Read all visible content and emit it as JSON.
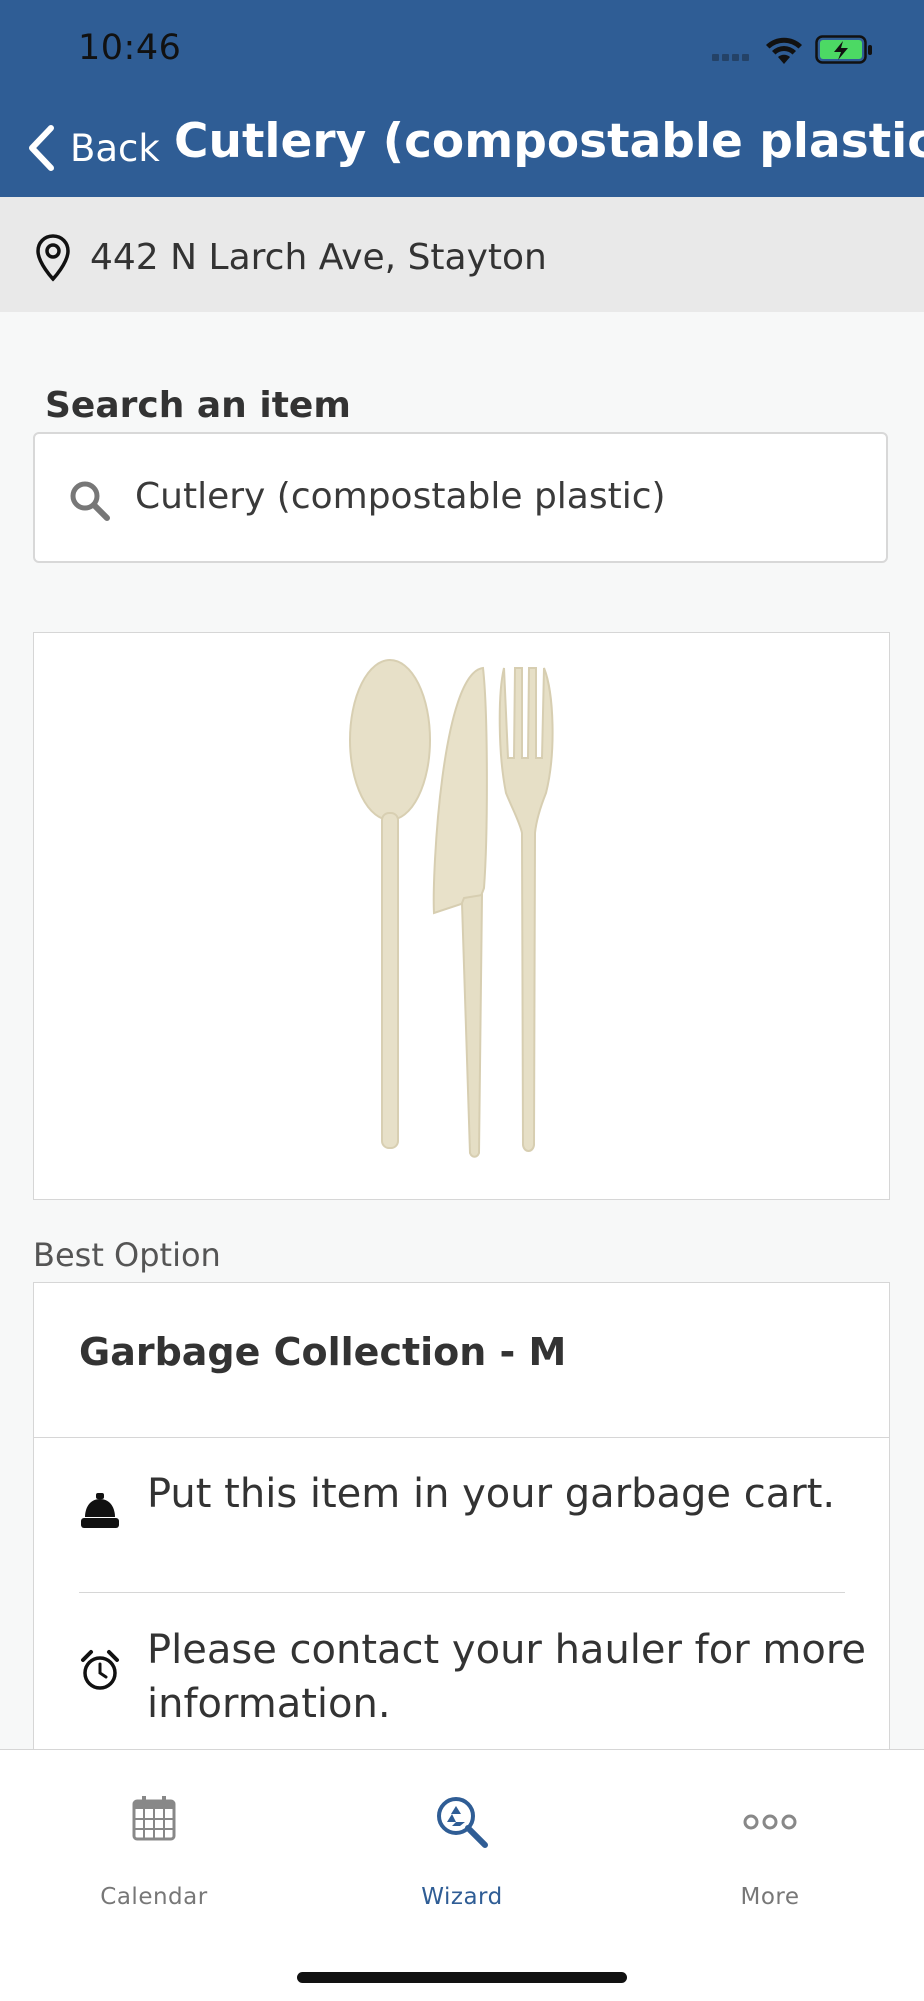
{
  "status_bar": {
    "time": "10:46"
  },
  "nav": {
    "back_label": "Back",
    "title": "Cutlery (compostable plastic)"
  },
  "address": {
    "text": "442 N Larch Ave, Stayton"
  },
  "search": {
    "label": "Search an item",
    "value": "Cutlery (compostable plastic)"
  },
  "item_image": {
    "description_icon": "cutlery-image"
  },
  "best_option": {
    "label": "Best Option",
    "title": "Garbage Collection - M",
    "instructions": [
      {
        "icon": "bell-icon",
        "text": "Put this item in your garbage cart."
      },
      {
        "icon": "alarm-clock-icon",
        "text": "Please contact your hauler for more information."
      }
    ]
  },
  "tabs": [
    {
      "label": "Calendar",
      "icon": "calendar-icon",
      "active": false
    },
    {
      "label": "Wizard",
      "icon": "recycle-search-icon",
      "active": true
    },
    {
      "label": "More",
      "icon": "more-icon",
      "active": false
    }
  ],
  "colors": {
    "header": "#2f5d95",
    "active_tab": "#2f5d95",
    "battery": "#4cd964"
  }
}
